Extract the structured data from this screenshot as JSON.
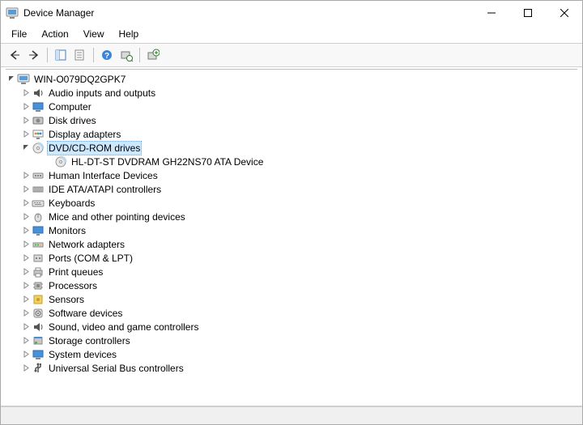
{
  "window": {
    "title": "Device Manager"
  },
  "menubar": {
    "items": [
      "File",
      "Action",
      "View",
      "Help"
    ]
  },
  "tree": {
    "root": {
      "label": "WIN-O079DQ2GPK7",
      "expanded": true,
      "children": [
        {
          "label": "Audio inputs and outputs",
          "icon": "audio",
          "expanded": false
        },
        {
          "label": "Computer",
          "icon": "computer",
          "expanded": false
        },
        {
          "label": "Disk drives",
          "icon": "disk",
          "expanded": false
        },
        {
          "label": "Display adapters",
          "icon": "display",
          "expanded": false
        },
        {
          "label": "DVD/CD-ROM drives",
          "icon": "dvd",
          "expanded": true,
          "selected": true,
          "children": [
            {
              "label": "HL-DT-ST DVDRAM GH22NS70 ATA Device",
              "icon": "dvd",
              "leaf": true
            }
          ]
        },
        {
          "label": "Human Interface Devices",
          "icon": "hid",
          "expanded": false
        },
        {
          "label": "IDE ATA/ATAPI controllers",
          "icon": "ide",
          "expanded": false
        },
        {
          "label": "Keyboards",
          "icon": "keyboard",
          "expanded": false
        },
        {
          "label": "Mice and other pointing devices",
          "icon": "mouse",
          "expanded": false
        },
        {
          "label": "Monitors",
          "icon": "monitor",
          "expanded": false
        },
        {
          "label": "Network adapters",
          "icon": "network",
          "expanded": false
        },
        {
          "label": "Ports (COM & LPT)",
          "icon": "port",
          "expanded": false
        },
        {
          "label": "Print queues",
          "icon": "printer",
          "expanded": false
        },
        {
          "label": "Processors",
          "icon": "processor",
          "expanded": false
        },
        {
          "label": "Sensors",
          "icon": "sensor",
          "expanded": false
        },
        {
          "label": "Software devices",
          "icon": "software",
          "expanded": false
        },
        {
          "label": "Sound, video and game controllers",
          "icon": "sound",
          "expanded": false
        },
        {
          "label": "Storage controllers",
          "icon": "storage",
          "expanded": false
        },
        {
          "label": "System devices",
          "icon": "system",
          "expanded": false
        },
        {
          "label": "Universal Serial Bus controllers",
          "icon": "usb",
          "expanded": false
        }
      ]
    }
  }
}
